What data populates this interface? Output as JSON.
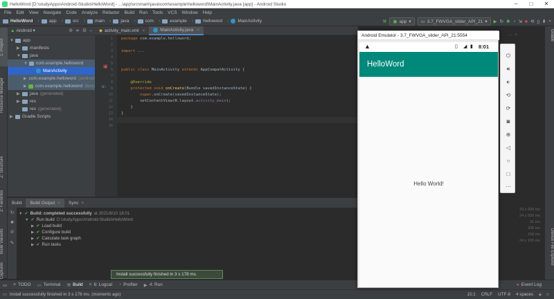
{
  "window": {
    "title": "HelloWord [D:\\studyApps\\Android-Studio\\HelloWord] - ...\\app\\src\\main\\java\\com\\example\\helloword\\MainActivity.java [app] - Android Studio"
  },
  "menu": [
    "File",
    "Edit",
    "View",
    "Navigate",
    "Code",
    "Analyze",
    "Refactor",
    "Build",
    "Run",
    "Tools",
    "VCS",
    "Window",
    "Help"
  ],
  "breadcrumb": [
    "HelloWord",
    "app",
    "src",
    "main",
    "java",
    "com",
    "example",
    "helloword",
    "MainActivity"
  ],
  "toolbar": {
    "run_config": "app",
    "device": "3.7_FWVGA_slider_API_21"
  },
  "project": {
    "view_mode": "Android",
    "tree": [
      {
        "label": "app",
        "indent": 0,
        "arrow": "▼",
        "icon": "folder"
      },
      {
        "label": "manifests",
        "indent": 1,
        "arrow": "▶",
        "icon": "folder"
      },
      {
        "label": "java",
        "indent": 1,
        "arrow": "▼",
        "icon": "folder"
      },
      {
        "label": "com.example.helloword",
        "indent": 2,
        "arrow": "▼",
        "icon": "pkg",
        "hl": true
      },
      {
        "label": "MainActivity",
        "indent": 3,
        "arrow": "",
        "icon": "class",
        "selected": true
      },
      {
        "label": "com.example.helloword",
        "suffix": "(androidTest)",
        "indent": 2,
        "arrow": "▶",
        "icon": "pkg",
        "hl": true
      },
      {
        "label": "com.example.helloword",
        "suffix": "(test)",
        "indent": 2,
        "arrow": "▶",
        "icon": "pkg-green",
        "hl": true
      },
      {
        "label": "java",
        "suffix": "(generated)",
        "indent": 1,
        "arrow": "▶",
        "icon": "folder"
      },
      {
        "label": "res",
        "indent": 1,
        "arrow": "▶",
        "icon": "folder"
      },
      {
        "label": "res",
        "suffix": "(generated)",
        "indent": 1,
        "arrow": "",
        "icon": "folder"
      },
      {
        "label": "Gradle Scripts",
        "indent": 0,
        "arrow": "▶",
        "icon": "gradle"
      }
    ]
  },
  "left_tabs": [
    "1: Project",
    "Resource Manager",
    "Z: Structure",
    "2: Favorites",
    "Build Variants",
    "Layout Captures"
  ],
  "right_tabs": [
    "Gradle",
    "Device File Explorer"
  ],
  "editor": {
    "tabs": [
      {
        "label": "activity_main.xml",
        "active": false
      },
      {
        "label": "MainActivity.java",
        "active": true
      }
    ],
    "line_numbers": [
      "1",
      "2",
      "3",
      "4",
      "5",
      "6",
      "7",
      "8",
      "9",
      "10",
      "11",
      "12",
      "13",
      "14",
      "15"
    ],
    "lines": [
      {
        "n": 1,
        "html": "<span class='kw'>package</span> com.example.helloword;"
      },
      {
        "n": 3,
        "html": "<span class='kw'>import</span> ..."
      },
      {
        "n": 6,
        "html": "<span class='kw'>public class</span> MainActivity <span class='kw'>extends</span> AppCompatActivity {"
      },
      {
        "n": 8,
        "html": "    <span class='an'>@Override</span>"
      },
      {
        "n": 9,
        "html": "    <span class='kw'>protected void</span> <span class='fn'>onCreate</span>(Bundle savedInstanceState) {"
      },
      {
        "n": 10,
        "html": "        <span class='kw'>super</span>.onCreate(savedInstanceState);"
      },
      {
        "n": 11,
        "html": "        setContentView(R.layout.<span class='fld'>activity_main</span>);"
      },
      {
        "n": 12,
        "html": "    }"
      },
      {
        "n": 13,
        "html": "}"
      }
    ]
  },
  "build": {
    "tabs": [
      "Build",
      "Build Output",
      "Sync"
    ],
    "rows": [
      {
        "text": "Build: completed successfully",
        "muted": "at 2021/8/10 18:01",
        "indent": 0,
        "arrow": "▼",
        "bold": true
      },
      {
        "text": "Run build",
        "muted": "D:\\studyApps\\Android-Studio\\HelloWord",
        "indent": 1,
        "arrow": "▼"
      },
      {
        "text": "Load build",
        "muted": "",
        "indent": 2,
        "arrow": "▶"
      },
      {
        "text": "Configure build",
        "muted": "",
        "indent": 2,
        "arrow": "▶"
      },
      {
        "text": "Calculate task graph",
        "muted": "",
        "indent": 2,
        "arrow": "▶"
      },
      {
        "text": "Run tasks",
        "muted": "",
        "indent": 2,
        "arrow": "▶"
      }
    ],
    "timings": [
      "29 s 908 ms",
      "24 s 939 ms",
      "31 ms",
      "338 ms",
      "158 ms",
      "24 s 165 ms"
    ]
  },
  "toast": "Install successfully finished in 3 s 178 ms.",
  "toolwindows": [
    {
      "label": "TODO",
      "icon": "≡"
    },
    {
      "label": "Terminal",
      "icon": "▭"
    },
    {
      "label": "Build",
      "icon": "⚒"
    },
    {
      "label": "6: Logcat",
      "icon": "≡"
    },
    {
      "label": "Profiler",
      "icon": "◔"
    },
    {
      "label": "4: Run",
      "icon": "▶"
    }
  ],
  "event_log": "Event Log",
  "status": {
    "message": "Install successfully finished in 3 s 178 ms. (moments ago)",
    "position": "15:1",
    "line_sep": "CRLF",
    "encoding": "UTF-8",
    "indent": "4 spaces"
  },
  "emulator": {
    "window_title": "Android Emulator - 3.7_FWVGA_slider_API_21:5554",
    "time": "8:01",
    "app_title": "HelloWord",
    "content": "Hello World!"
  },
  "colors": {
    "app_bar": "#00897b",
    "ide_bg": "#2b2b2b",
    "panel_bg": "#3c3f41",
    "selection": "#2f65ca",
    "success": "#5fb55c"
  }
}
